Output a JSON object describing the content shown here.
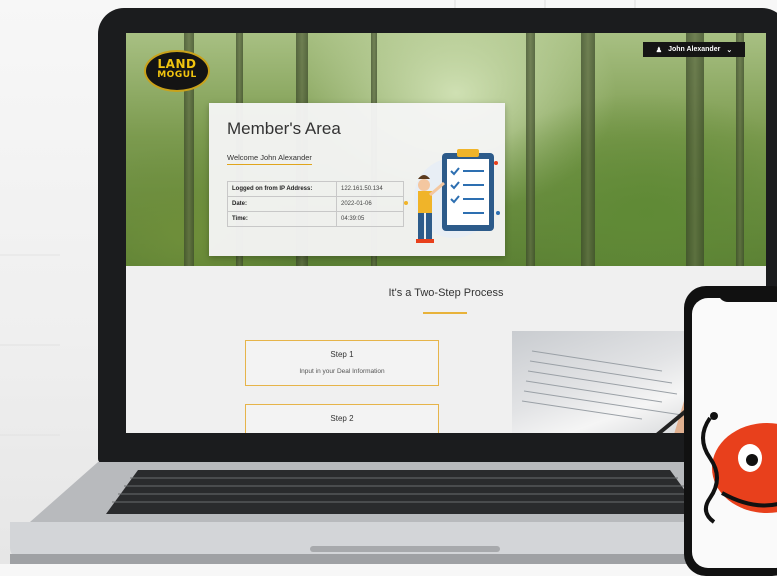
{
  "app": {
    "logo_line1": "LAND",
    "logo_line2": "MOGUL",
    "user_menu": {
      "name": "John Alexander",
      "icon": "user-icon",
      "caret": "chevron-down-icon"
    }
  },
  "member_area": {
    "title": "Member's Area",
    "welcome": "Welcome John Alexander",
    "rows": [
      {
        "label": "Logged on from IP Address:",
        "value": "122.161.50.134"
      },
      {
        "label": "Date:",
        "value": "2022-01-06"
      },
      {
        "label": "Time:",
        "value": "04:39:05"
      }
    ]
  },
  "process": {
    "title": "It's a Two-Step Process",
    "steps": [
      {
        "title": "Step 1",
        "desc": "Input in your Deal Information"
      },
      {
        "title": "Step 2",
        "desc": ""
      }
    ]
  },
  "colors": {
    "accent": "#e8b23a",
    "logo_gold": "#f1c40f",
    "bezel": "#1b1c1e",
    "mascot_red": "#e8401c"
  }
}
